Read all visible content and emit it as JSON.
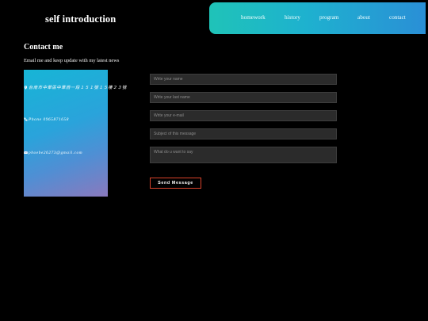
{
  "site": {
    "title": "self introduction"
  },
  "nav": {
    "items": [
      "homework",
      "history",
      "program",
      "about",
      "contact"
    ]
  },
  "contact": {
    "title": "Contact me",
    "subtitle": "Email me and keep update with my latest news",
    "address": "台南市中華區中華西一段１５１號１５樓２３號",
    "phone": "Phone 0965871658",
    "email": "phoebe26273@gmail.com"
  },
  "form": {
    "name_placeholder": "Write your name",
    "lastname_placeholder": "Write your last name",
    "email_placeholder": "Write your e-mail",
    "subject_placeholder": "Subject of this message",
    "message_placeholder": "What do u want to say",
    "send_label": "Send Message"
  },
  "colors": {
    "nav_start": "#1fc3b8",
    "nav_end": "#2a8fd6",
    "button_border": "#d8432b"
  }
}
